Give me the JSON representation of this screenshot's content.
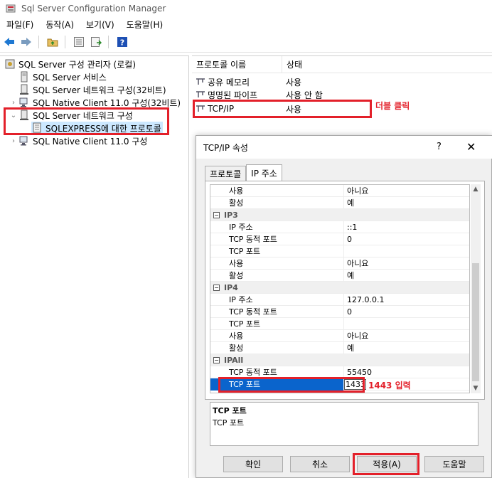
{
  "window": {
    "title": "Sql Server Configuration Manager"
  },
  "menu": [
    "파일(F)",
    "동작(A)",
    "보기(V)",
    "도움말(H)"
  ],
  "tree": {
    "root": "SQL Server 구성 관리자 (로컬)",
    "items": [
      "SQL Server 서비스",
      "SQL Server 네트워크 구성(32비트)",
      "SQL Native Client 11.0 구성(32비트)",
      "SQL Server 네트워크 구성",
      "SQLEXPRESS에 대한 프로토콜",
      "SQL Native Client 11.0 구성"
    ]
  },
  "protocol_list": {
    "headers": {
      "name": "프로토콜 이름",
      "state": "상태"
    },
    "rows": [
      {
        "name": "공유 메모리",
        "state": "사용"
      },
      {
        "name": "명명된 파이프",
        "state": "사용 안 함"
      },
      {
        "name": "TCP/IP",
        "state": "사용"
      }
    ]
  },
  "annotations": {
    "double_click": "더블 클릭",
    "enter_port": "1443 입력"
  },
  "dialog": {
    "title": "TCP/IP 속성",
    "help": "?",
    "close": "✕",
    "tabs": [
      "프로토콜",
      "IP 주소"
    ],
    "grid": [
      {
        "key": "사용",
        "value": "아니요"
      },
      {
        "key": "활성",
        "value": "예"
      },
      {
        "category": "IP3"
      },
      {
        "key": "IP 주소",
        "value": "::1"
      },
      {
        "key": "TCP 동적 포트",
        "value": "0"
      },
      {
        "key": "TCP 포트",
        "value": ""
      },
      {
        "key": "사용",
        "value": "아니요"
      },
      {
        "key": "활성",
        "value": "예"
      },
      {
        "category": "IP4"
      },
      {
        "key": "IP 주소",
        "value": "127.0.0.1"
      },
      {
        "key": "TCP 동적 포트",
        "value": "0"
      },
      {
        "key": "TCP 포트",
        "value": ""
      },
      {
        "key": "사용",
        "value": "아니요"
      },
      {
        "key": "활성",
        "value": "예"
      },
      {
        "category": "IPAll"
      },
      {
        "key": "TCP 동적 포트",
        "value": "55450"
      },
      {
        "key": "TCP 포트",
        "value": "1433",
        "selected": true
      }
    ],
    "description": {
      "title": "TCP 포트",
      "text": "TCP 포트"
    },
    "buttons": {
      "ok": "확인",
      "cancel": "취소",
      "apply": "적용(A)",
      "help": "도움말"
    }
  },
  "colors": {
    "annotation": "#e3202a",
    "selection": "#0a64cc"
  }
}
